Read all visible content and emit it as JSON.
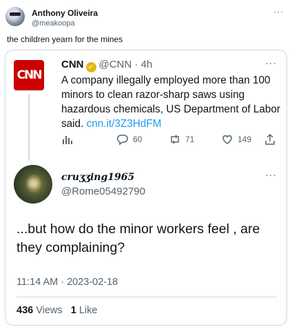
{
  "outer": {
    "name": "Anthony Oliveira",
    "handle": "@meakoopa",
    "more": "···",
    "text": "the children yearn for the mines"
  },
  "quoted": {
    "logo_text": "CNN",
    "name": "CNN",
    "handle": "@CNN",
    "separator": "·",
    "time": "4h",
    "more": "···",
    "body": "A company illegally employed more than 100 minors to clean razor-sharp saws using hazardous chemicals, US Department of Labor said.",
    "link": "cnn.it/3Z3HdFM",
    "actions": {
      "replies": "60",
      "retweets": "71",
      "likes": "149"
    },
    "verified_color": "#e2b719"
  },
  "reply": {
    "name": "cruʒʒing1965",
    "handle": "@Rome05492790",
    "more": "···",
    "body": "...but how do the minor workers feel , are they complaining?",
    "timestamp": "11:14 AM · 2023-02-18",
    "views_count": "436",
    "views_label": "Views",
    "likes_count": "1",
    "likes_label": "Like"
  },
  "colors": {
    "link": "#1d9bf0",
    "muted": "#536471",
    "cnn_red": "#cc0000",
    "border": "#cfd9de"
  },
  "icons": [
    "analytics-icon",
    "reply-icon",
    "retweet-icon",
    "like-icon",
    "share-icon",
    "verified-badge-icon",
    "more-icon"
  ]
}
